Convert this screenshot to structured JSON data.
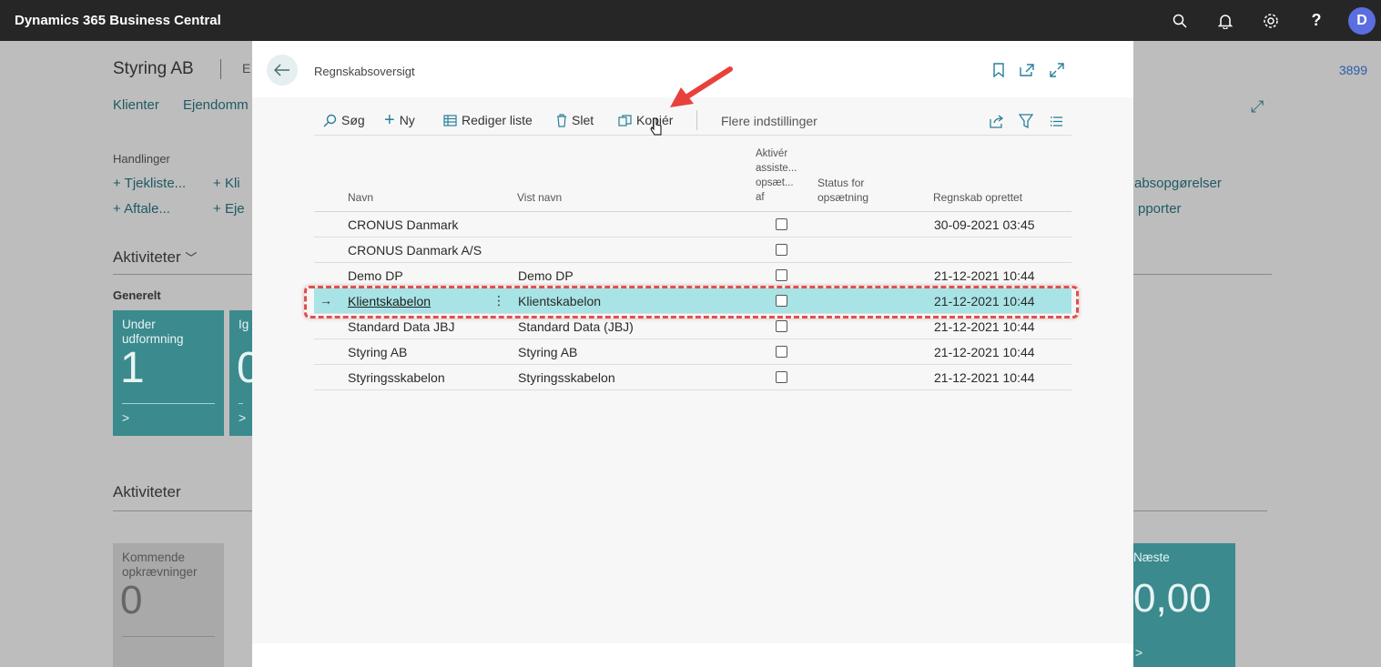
{
  "app": {
    "title": "Dynamics 365 Business Central",
    "avatar_initial": "D"
  },
  "topbar_icons": [
    "search-icon",
    "bell-icon",
    "gear-icon",
    "help-icon"
  ],
  "background": {
    "title": "Styring AB",
    "title_2": "E",
    "right_number": "3899",
    "nav": [
      "Klienter",
      "Ejendomm"
    ],
    "handlinger_label": "Handlinger",
    "actions_left": [
      "Tjekliste...",
      "Aftale..."
    ],
    "actions_mid": [
      "Kli",
      "Eje"
    ],
    "actions_right": [
      "absopgørelser",
      "pporter"
    ],
    "aktiviteter_1": "Aktiviteter",
    "generelt": "Generelt",
    "tile_1": {
      "label_1": "Under",
      "label_2": "udformning",
      "value": "1"
    },
    "tile_2": {
      "label": "Ig",
      "value": "0"
    },
    "aktiviteter_2": "Aktiviteter",
    "tile_3": {
      "label_1": "Kommende",
      "label_2": "opkrævninger",
      "value": "0"
    },
    "tile_4": {
      "label": "Næste",
      "value": "0,00"
    }
  },
  "modal": {
    "title": "Regnskabsoversigt",
    "toolbar": {
      "search": "Søg",
      "new": "Ny",
      "edit_list": "Rediger liste",
      "delete": "Slet",
      "copy": "Kopiér",
      "more": "Flere indstillinger"
    },
    "columns": {
      "name": "Navn",
      "display_name": "Vist navn",
      "activate_1": "Aktivér",
      "activate_2": "assiste...",
      "activate_3": "opsæt...",
      "activate_4": "af",
      "status_1": "Status for",
      "status_2": "opsætning",
      "created": "Regnskab oprettet"
    },
    "rows": [
      {
        "name": "CRONUS Danmark",
        "display_name": "",
        "created": "30-09-2021 03:45"
      },
      {
        "name": "CRONUS Danmark A/S",
        "display_name": "",
        "created": ""
      },
      {
        "name": "Demo DP",
        "display_name": "Demo DP",
        "created": "21-12-2021 10:44"
      },
      {
        "name": "Klientskabelon",
        "display_name": "Klientskabelon",
        "created": "21-12-2021 10:44"
      },
      {
        "name": "Standard Data JBJ",
        "display_name": "Standard Data (JBJ)",
        "created": "21-12-2021 10:44"
      },
      {
        "name": "Styring AB",
        "display_name": "Styring AB",
        "created": "21-12-2021 10:44"
      },
      {
        "name": "Styringsskabelon",
        "display_name": "Styringsskabelon",
        "created": "21-12-2021 10:44"
      }
    ],
    "selected_row": 3
  },
  "colors": {
    "accent": "#2a7f9a",
    "selected_row": "#a8e3e5",
    "annotation": "#d9534f"
  }
}
